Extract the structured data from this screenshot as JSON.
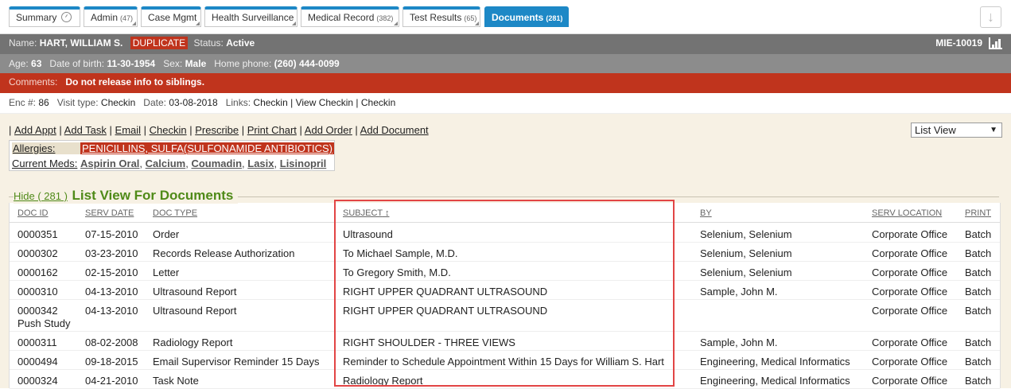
{
  "tabs": [
    {
      "label": "Summary",
      "count": ""
    },
    {
      "label": "Admin",
      "count": "(47)"
    },
    {
      "label": "Case Mgmt",
      "count": ""
    },
    {
      "label": "Health Surveillance",
      "count": ""
    },
    {
      "label": "Medical Record",
      "count": "(382)"
    },
    {
      "label": "Test Results",
      "count": "(65)"
    },
    {
      "label": "Documents",
      "count": "(281)"
    }
  ],
  "patient": {
    "name_label": "Name:",
    "name": "HART, WILLIAM S.",
    "duplicate": "DUPLICATE",
    "status_label": "Status:",
    "status": "Active",
    "mrn": "MIE-10019",
    "age_label": "Age:",
    "age": "63",
    "dob_label": "Date of birth:",
    "dob": "11-30-1954",
    "sex_label": "Sex:",
    "sex": "Male",
    "phone_label": "Home phone:",
    "phone": "(260) 444-0099",
    "comments_label": "Comments:",
    "comments": "Do not release info to siblings."
  },
  "encounter": {
    "enc_label": "Enc #:",
    "enc": "86",
    "visit_label": "Visit type:",
    "visit": "Checkin",
    "date_label": "Date:",
    "date": "03-08-2018",
    "links_label": "Links:",
    "link1": "Checkin",
    "link2": "View Checkin",
    "link3": "Checkin"
  },
  "actions": [
    "Add Appt",
    "Add Task",
    "Email",
    "Checkin",
    "Prescribe",
    "Print Chart",
    "Add Order",
    "Add Document"
  ],
  "view_select": "List View",
  "allergies": {
    "label": "Allergies:",
    "value": "PENICILLINS, SULFA(SULFONAMIDE ANTIBIOTICS)"
  },
  "meds": {
    "label": "Current Meds:",
    "items": [
      "Aspirin Oral",
      "Calcium",
      "Coumadin",
      "Lasix",
      "Lisinopril"
    ]
  },
  "section": {
    "hide": "Hide ( 281 )",
    "title": "List View For Documents"
  },
  "columns": [
    "DOC ID",
    "SERV DATE",
    "DOC TYPE",
    "SUBJECT",
    "BY",
    "SERV LOCATION",
    "PRINT"
  ],
  "sort_indicator": "↕",
  "rows": [
    {
      "id": "0000351",
      "date": "07-15-2010",
      "type": "Order",
      "subject": "Ultrasound",
      "by": "Selenium, Selenium",
      "loc": "Corporate Office",
      "print": "Batch",
      "sub": ""
    },
    {
      "id": "0000302",
      "date": "03-23-2010",
      "type": "Records Release Authorization",
      "subject": "To Michael Sample, M.D.",
      "by": "Selenium, Selenium",
      "loc": "Corporate Office",
      "print": "Batch",
      "sub": ""
    },
    {
      "id": "0000162",
      "date": "02-15-2010",
      "type": "Letter",
      "subject": "To Gregory Smith, M.D.",
      "by": "Selenium, Selenium",
      "loc": "Corporate Office",
      "print": "Batch",
      "sub": ""
    },
    {
      "id": "0000310",
      "date": "04-13-2010",
      "type": "Ultrasound Report",
      "subject": "RIGHT UPPER QUADRANT ULTRASOUND",
      "by": "Sample, John M.",
      "loc": "Corporate Office",
      "print": "Batch",
      "sub": ""
    },
    {
      "id": "0000342",
      "date": "04-13-2010",
      "type": "Ultrasound Report",
      "subject": "RIGHT UPPER QUADRANT ULTRASOUND",
      "by": "",
      "loc": "Corporate Office",
      "print": "Batch",
      "sub": "Push Study"
    },
    {
      "id": "0000311",
      "date": "08-02-2008",
      "type": "Radiology Report",
      "subject": "RIGHT SHOULDER - THREE VIEWS",
      "by": "Sample, John M.",
      "loc": "Corporate Office",
      "print": "Batch",
      "sub": ""
    },
    {
      "id": "0000494",
      "date": "09-18-2015",
      "type": "Email Supervisor Reminder 15 Days",
      "subject": "Reminder to Schedule Appointment Within 15 Days for William S. Hart",
      "by": "Engineering, Medical Informatics",
      "loc": "Corporate Office",
      "print": "Batch",
      "sub": ""
    },
    {
      "id": "0000324",
      "date": "04-21-2010",
      "type": "Task Note",
      "subject": "Radiology Report",
      "by": "Engineering, Medical Informatics",
      "loc": "Corporate Office",
      "print": "Batch",
      "sub": ""
    }
  ]
}
